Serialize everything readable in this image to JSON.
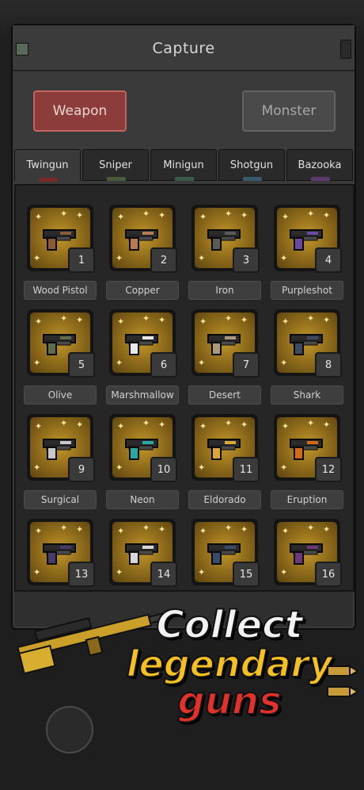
{
  "header": {
    "title": "Capture"
  },
  "mode_buttons": {
    "weapon": "Weapon",
    "monster": "Monster"
  },
  "tabs": [
    {
      "label": "Twingun",
      "active": true,
      "color": "#7a2a2a"
    },
    {
      "label": "Sniper",
      "active": false,
      "color": "#4a5a3a"
    },
    {
      "label": "Minigun",
      "active": false,
      "color": "#3a5a4a"
    },
    {
      "label": "Shotgun",
      "active": false,
      "color": "#3a5a6a"
    },
    {
      "label": "Bazooka",
      "active": false,
      "color": "#5a3a6a"
    }
  ],
  "items": [
    {
      "number": "1",
      "name": "Wood Pistol",
      "color": "#8a5a38"
    },
    {
      "number": "2",
      "name": "Copper",
      "color": "#b77a55"
    },
    {
      "number": "3",
      "name": "Iron",
      "color": "#5a5a5a"
    },
    {
      "number": "4",
      "name": "Purpleshot",
      "color": "#6a4aa0"
    },
    {
      "number": "5",
      "name": "Olive",
      "color": "#5f6b4a"
    },
    {
      "number": "6",
      "name": "Marshmallow",
      "color": "#e8e8e8"
    },
    {
      "number": "7",
      "name": "Desert",
      "color": "#a89a7a"
    },
    {
      "number": "8",
      "name": "Shark",
      "color": "#3e4a5e"
    },
    {
      "number": "9",
      "name": "Surgical",
      "color": "#c8c8c8"
    },
    {
      "number": "10",
      "name": "Neon",
      "color": "#2aa7a0"
    },
    {
      "number": "11",
      "name": "Eldorado",
      "color": "#d9a63a"
    },
    {
      "number": "12",
      "name": "Eruption",
      "color": "#d26a1a"
    },
    {
      "number": "13",
      "name": "",
      "color": "#4a3a6a"
    },
    {
      "number": "14",
      "name": "",
      "color": "#d8d8d8"
    },
    {
      "number": "15",
      "name": "",
      "color": "#3a4a6a"
    },
    {
      "number": "16",
      "name": "",
      "color": "#6a3a7a"
    }
  ],
  "promo": {
    "line1": "Collect",
    "line2": "legendary",
    "line3": "guns"
  }
}
